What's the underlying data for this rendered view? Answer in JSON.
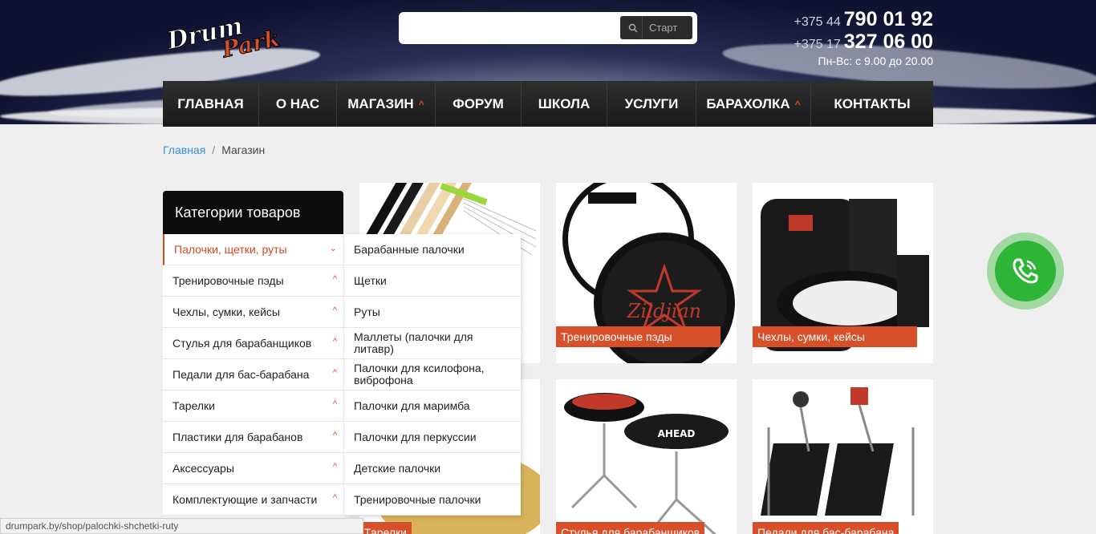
{
  "brand": {
    "logo_text": "DrumPark"
  },
  "search": {
    "placeholder": "",
    "button_label": "Старт"
  },
  "contacts": {
    "phones": [
      {
        "code": "+375 44",
        "number": "790 01 92"
      },
      {
        "code": "+375 17",
        "number": "327 06 00"
      }
    ],
    "hours": "Пн-Вс: с 9.00 до 20.00"
  },
  "nav": {
    "items": [
      {
        "label": "ГЛАВНАЯ",
        "caret": ""
      },
      {
        "label": "О НАС",
        "caret": ""
      },
      {
        "label": "МАГАЗИН",
        "caret": "^"
      },
      {
        "label": "ФОРУМ",
        "caret": ""
      },
      {
        "label": "ШКОЛА",
        "caret": ""
      },
      {
        "label": "УСЛУГИ",
        "caret": ""
      },
      {
        "label": "БАРАХОЛКА",
        "caret": "^"
      },
      {
        "label": "КОНТАКТЫ",
        "caret": ""
      }
    ]
  },
  "breadcrumb": {
    "home": "Главная",
    "separator": "/",
    "current": "Магазин"
  },
  "categories": {
    "title": "Категории товаров",
    "items": [
      {
        "label": "Палочки, щетки, руты",
        "chevron": "⌄"
      },
      {
        "label": "Тренировочные пэды",
        "chevron": "^"
      },
      {
        "label": "Чехлы, сумки, кейсы",
        "chevron": "^"
      },
      {
        "label": "Стулья для барабанщиков",
        "chevron": "^"
      },
      {
        "label": "Педали для бас-барабана",
        "chevron": "^"
      },
      {
        "label": "Тарелки",
        "chevron": "^"
      },
      {
        "label": "Пластики для барабанов",
        "chevron": "^"
      },
      {
        "label": "Аксессуары",
        "chevron": "^"
      },
      {
        "label": "Комплектующие и запчасти",
        "chevron": "^"
      }
    ],
    "subitems": [
      "Барабанные палочки",
      "Щетки",
      "Руты",
      "Маллеты (палочки для литавр)",
      "Палочки для ксилофона, виброфона",
      "Палочки для маримба",
      "Палочки для перкуссии",
      "Детские палочки",
      "Тренировочные палочки"
    ]
  },
  "products": [
    {
      "label": ""
    },
    {
      "label": "Тренировочные пэды"
    },
    {
      "label": "Чехлы, сумки, кейсы"
    },
    {
      "label": "Тарелки"
    },
    {
      "label": "Стулья для барабанщиков"
    },
    {
      "label": "Педали для бас-барабана"
    }
  ],
  "statusbar": {
    "url": "drumpark.by/shop/palochki-shchetki-ruty"
  },
  "colors": {
    "accent": "#d8502a",
    "call_green": "#2db535",
    "link": "#3a8fd1"
  }
}
